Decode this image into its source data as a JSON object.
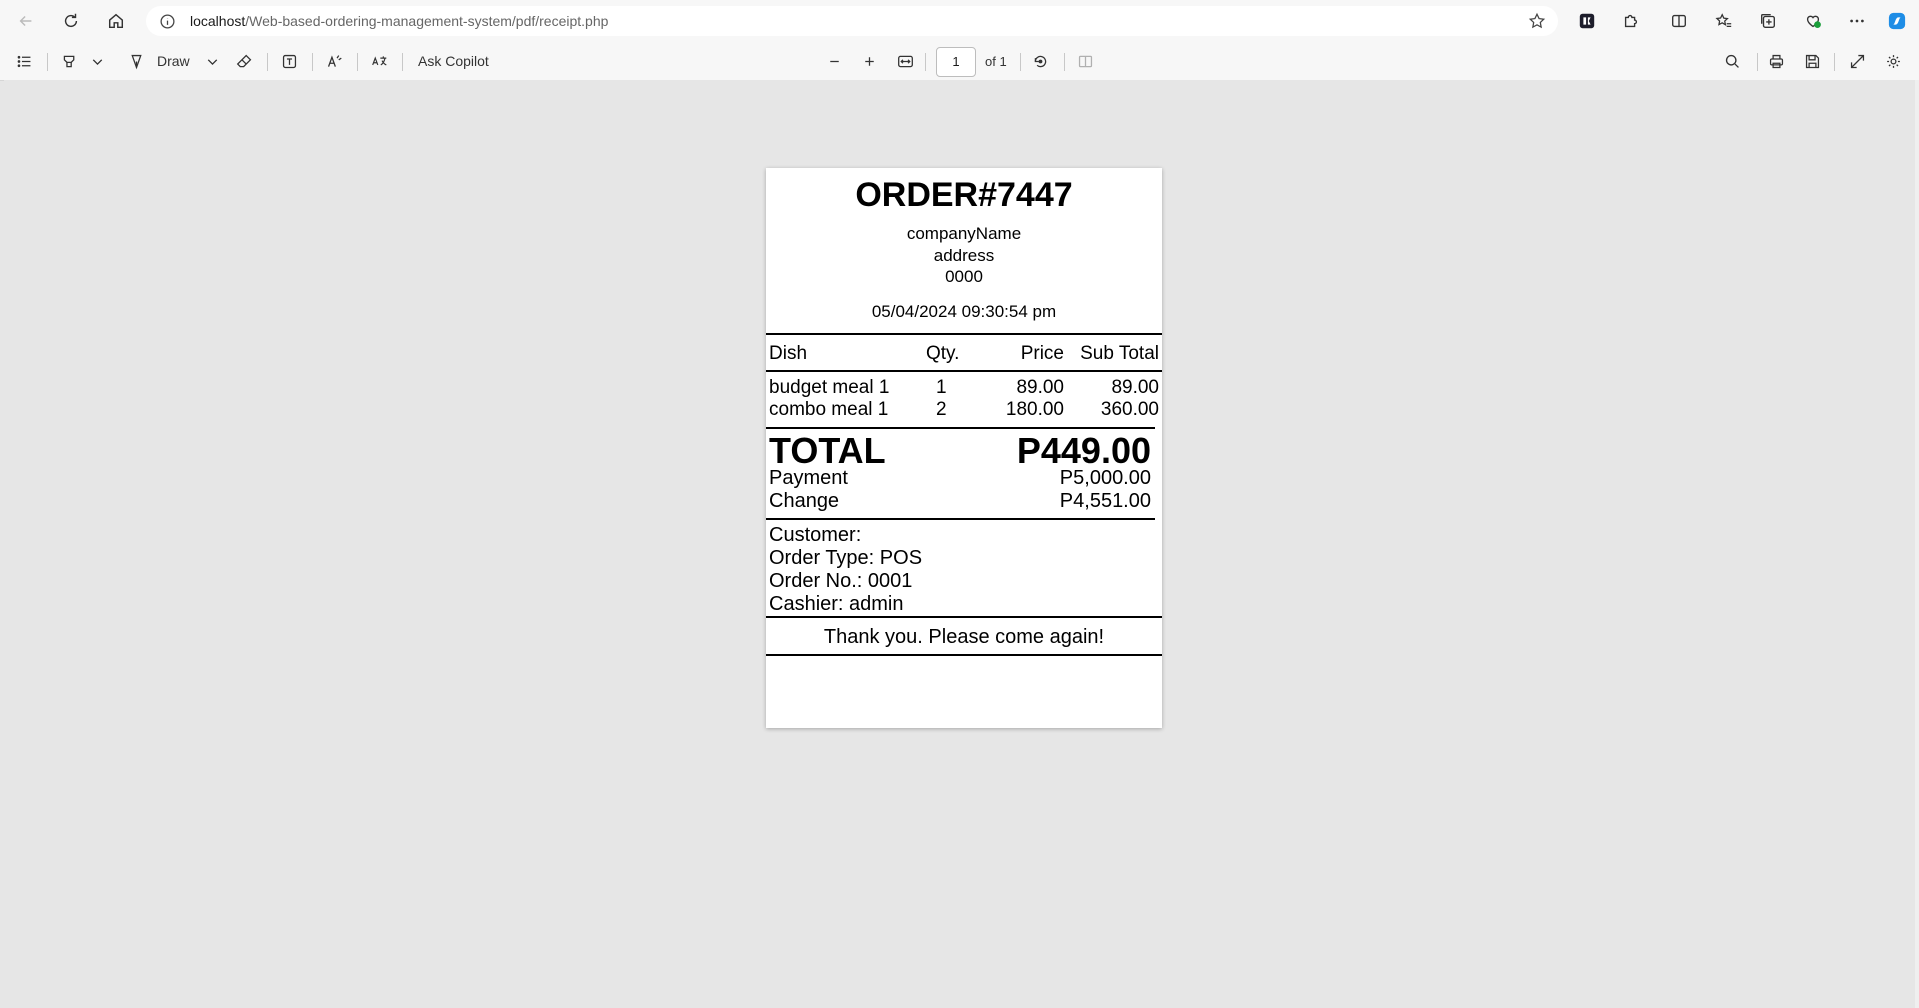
{
  "browser": {
    "url_host": "localhost",
    "url_path": "/Web-based-ordering-management-system/pdf/receipt.php"
  },
  "pdf_toolbar": {
    "draw_label": "Draw",
    "copilot_label": "Ask Copilot",
    "page_current": "1",
    "page_total": "of 1"
  },
  "receipt": {
    "title": "ORDER#7447",
    "company": "companyName",
    "address": "address",
    "phone": "0000",
    "datetime": "05/04/2024 09:30:54 pm",
    "columns": [
      "Dish",
      "Qty.",
      "Price",
      "Sub Total"
    ],
    "items": [
      {
        "dish": "budget meal 1",
        "qty": "1",
        "price": "89.00",
        "subtotal": "89.00"
      },
      {
        "dish": "combo meal 1",
        "qty": "2",
        "price": "180.00",
        "subtotal": "360.00"
      }
    ],
    "total_label": "TOTAL",
    "total_value": "P449.00",
    "payment_label": "Payment",
    "payment_value": "P5,000.00",
    "change_label": "Change",
    "change_value": "P4,551.00",
    "customer": "Customer:",
    "order_type": "Order Type: POS",
    "order_no": "Order No.: 0001",
    "cashier": "Cashier: admin",
    "thanks": "Thank you. Please come again!"
  }
}
